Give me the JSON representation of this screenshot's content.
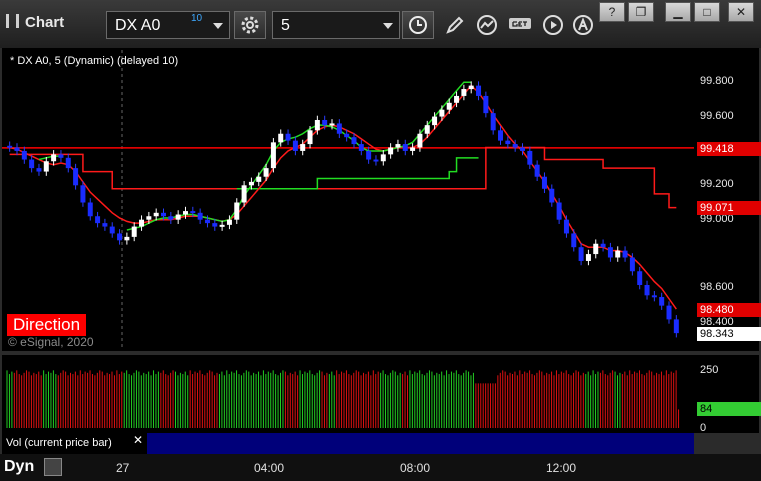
{
  "app": {
    "title": "Chart"
  },
  "toolbar": {
    "symbol": "DX A0",
    "symbol_delay": "10",
    "interval": "5"
  },
  "chart": {
    "legend": "* DX A0, 5 (Dynamic) (delayed 10)",
    "direction_label": "Direction",
    "copyright": "© eSignal, 2020",
    "y_ticks": [
      "99.800",
      "99.600",
      "99.200",
      "99.000",
      "98.600",
      "98.400"
    ],
    "price_badges": [
      {
        "text": "99.418",
        "color": "#e00000"
      },
      {
        "text": "99.071",
        "color": "#e00000"
      },
      {
        "text": "98.480",
        "color": "#e00000"
      },
      {
        "text": "98.343",
        "color": "#ffffff"
      }
    ],
    "x_ticks": [
      "27",
      "04:00",
      "08:00",
      "12:00"
    ],
    "volume_label": "Vol (current price bar)",
    "volume_ticks": [
      "250",
      "0"
    ],
    "volume_badge": "84",
    "dyn_label": "Dyn"
  },
  "chart_data": {
    "type": "candlestick",
    "ylim": [
      98.3,
      99.9
    ],
    "close": [
      99.42,
      99.4,
      99.35,
      99.3,
      99.28,
      99.34,
      99.38,
      99.36,
      99.3,
      99.2,
      99.1,
      99.02,
      98.98,
      98.96,
      98.92,
      98.88,
      98.9,
      98.96,
      99.0,
      99.02,
      99.04,
      99.02,
      99.0,
      99.03,
      99.05,
      99.04,
      99.0,
      98.98,
      98.96,
      98.97,
      99.0,
      99.1,
      99.2,
      99.22,
      99.25,
      99.3,
      99.45,
      99.5,
      99.46,
      99.4,
      99.44,
      99.52,
      99.58,
      99.55,
      99.56,
      99.5,
      99.48,
      99.44,
      99.4,
      99.35,
      99.34,
      99.38,
      99.42,
      99.44,
      99.4,
      99.42,
      99.5,
      99.55,
      99.6,
      99.64,
      99.68,
      99.72,
      99.76,
      99.78,
      99.72,
      99.62,
      99.52,
      99.46,
      99.44,
      99.42,
      99.4,
      99.32,
      99.25,
      99.18,
      99.1,
      99.0,
      98.92,
      98.84,
      98.76,
      98.8,
      98.86,
      98.84,
      98.78,
      98.82,
      98.78,
      98.7,
      98.62,
      98.56,
      98.55,
      98.5,
      98.42,
      98.34
    ],
    "trend_red": [
      99.42,
      99.41,
      99.39,
      99.37,
      99.35,
      99.33,
      99.32,
      99.33,
      99.32,
      99.28,
      99.22,
      99.16,
      99.12,
      99.08,
      99.04,
      99.01,
      98.99,
      98.98,
      98.98,
      98.99,
      99.0,
      99.0,
      99.0,
      99.01,
      99.02,
      99.02,
      99.02,
      99.01,
      99.0,
      98.99,
      99.0,
      99.03,
      99.08,
      99.13,
      99.18,
      99.23,
      99.3,
      99.36,
      99.4,
      99.42,
      99.44,
      99.48,
      99.52,
      99.54,
      99.55,
      99.54,
      99.52,
      99.5,
      99.47,
      99.44,
      99.41,
      99.4,
      99.41,
      99.42,
      99.42,
      99.42,
      99.44,
      99.48,
      99.53,
      99.58,
      99.63,
      99.68,
      99.73,
      99.78,
      99.74,
      99.68,
      99.61,
      99.55,
      99.49,
      99.44,
      99.4,
      99.34,
      99.28,
      99.22,
      99.15,
      99.08,
      99.0,
      98.93,
      98.86,
      98.84,
      98.84,
      98.84,
      98.82,
      98.82,
      98.81,
      98.78,
      98.74,
      98.69,
      98.64,
      98.6,
      98.54,
      98.48
    ],
    "trend_green": [
      null,
      null,
      null,
      null,
      99.35,
      99.36,
      99.37,
      99.37,
      null,
      null,
      null,
      null,
      null,
      null,
      null,
      null,
      98.94,
      98.95,
      98.96,
      98.98,
      99.0,
      99.01,
      99.01,
      99.02,
      99.03,
      99.03,
      99.02,
      99.01,
      99.0,
      98.99,
      99.0,
      99.06,
      99.14,
      99.2,
      99.26,
      99.32,
      99.4,
      99.45,
      99.47,
      99.48,
      99.5,
      99.53,
      99.55,
      99.55,
      99.54,
      99.52,
      99.49,
      99.46,
      99.42,
      99.4,
      99.4,
      99.4,
      99.41,
      99.42,
      99.43,
      99.45,
      99.5,
      99.55,
      99.6,
      99.65,
      99.7,
      99.75,
      99.8,
      99.8,
      null,
      null,
      null,
      null,
      null,
      null,
      null,
      null,
      null,
      null,
      null,
      null,
      null,
      null,
      null,
      null,
      null,
      null,
      null,
      null,
      null,
      null,
      null,
      null,
      null,
      null,
      null
    ],
    "stop_red": [
      99.38,
      99.38,
      99.38,
      99.38,
      99.38,
      99.38,
      99.38,
      99.38,
      99.38,
      99.38,
      99.28,
      99.28,
      99.28,
      99.28,
      99.18,
      99.18,
      99.18,
      99.18,
      99.18,
      99.18,
      99.18,
      99.18,
      99.18,
      99.18,
      99.18,
      99.18,
      99.18,
      99.18,
      99.18,
      99.18,
      99.18,
      99.18,
      99.18,
      99.18,
      99.18,
      99.18,
      99.18,
      99.18,
      99.18,
      99.18,
      99.18,
      99.18,
      99.18,
      99.18,
      99.18,
      99.18,
      99.18,
      99.18,
      99.18,
      99.18,
      99.18,
      99.18,
      99.18,
      99.18,
      99.18,
      99.18,
      99.18,
      99.18,
      99.18,
      99.18,
      99.18,
      99.18,
      99.18,
      99.18,
      99.18,
      99.42,
      99.42,
      99.42,
      99.42,
      99.42,
      99.42,
      99.42,
      99.42,
      99.35,
      99.35,
      99.35,
      99.35,
      99.35,
      99.35,
      99.35,
      99.35,
      99.3,
      99.3,
      99.3,
      99.3,
      99.3,
      99.3,
      99.3,
      99.15,
      99.15,
      99.07,
      99.07
    ],
    "stop_green": [
      null,
      null,
      null,
      null,
      null,
      null,
      null,
      null,
      null,
      null,
      null,
      null,
      null,
      null,
      null,
      null,
      null,
      null,
      null,
      null,
      null,
      null,
      null,
      null,
      null,
      null,
      null,
      null,
      null,
      null,
      null,
      99.18,
      99.18,
      99.18,
      99.18,
      99.18,
      99.18,
      99.18,
      99.18,
      99.18,
      99.18,
      99.18,
      99.24,
      99.24,
      99.24,
      99.24,
      99.24,
      99.24,
      99.24,
      99.24,
      99.24,
      99.24,
      99.24,
      99.24,
      99.24,
      99.24,
      99.24,
      99.24,
      99.24,
      99.24,
      99.28,
      99.36,
      99.36,
      99.36,
      99.36,
      null,
      null,
      null,
      null,
      null,
      null,
      null,
      null,
      null,
      null,
      null,
      null,
      null,
      null,
      null,
      null,
      null,
      null,
      null,
      null,
      null,
      null,
      null,
      null,
      null,
      null,
      null
    ],
    "horizontal_line": 99.418
  }
}
